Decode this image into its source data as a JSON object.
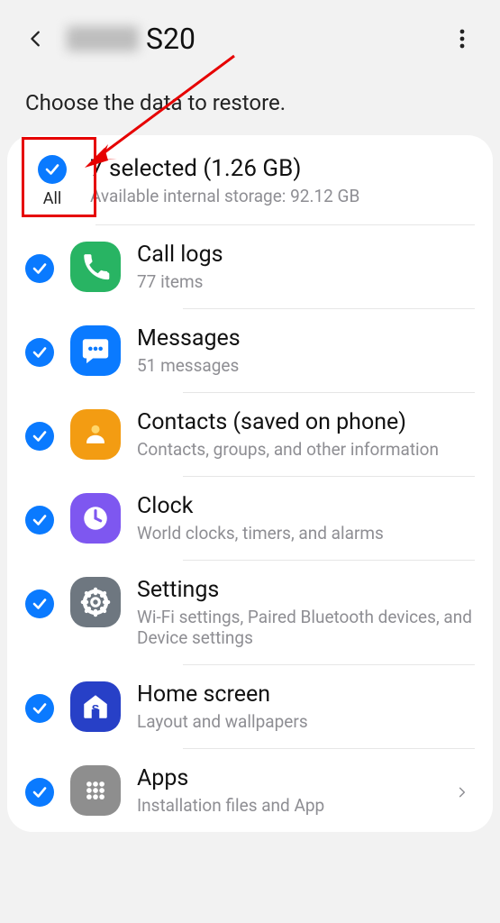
{
  "header": {
    "device_suffix": "S20"
  },
  "instruction": "Choose the data to restore.",
  "summary": {
    "title": "7 selected (1.26 GB)",
    "subtitle": "Available internal storage: 92.12 GB",
    "all_label": "All"
  },
  "items": [
    {
      "icon": "phone-icon",
      "bg": "bg-green",
      "title": "Call logs",
      "sub": "77 items"
    },
    {
      "icon": "messages-icon",
      "bg": "bg-blue",
      "title": "Messages",
      "sub": "51 messages"
    },
    {
      "icon": "contacts-icon",
      "bg": "bg-orange",
      "title": "Contacts (saved on phone)",
      "sub": "Contacts, groups, and other information"
    },
    {
      "icon": "clock-icon",
      "bg": "bg-purple",
      "title": "Clock",
      "sub": "World clocks, timers, and alarms"
    },
    {
      "icon": "settings-icon",
      "bg": "bg-gray",
      "title": "Settings",
      "sub": "Wi-Fi settings, Paired Bluetooth devices, and Device settings"
    },
    {
      "icon": "home-icon",
      "bg": "bg-indigo",
      "title": "Home screen",
      "sub": "Layout and wallpapers"
    },
    {
      "icon": "apps-icon",
      "bg": "bg-darkgray",
      "title": "Apps",
      "sub": "Installation files and App"
    }
  ]
}
